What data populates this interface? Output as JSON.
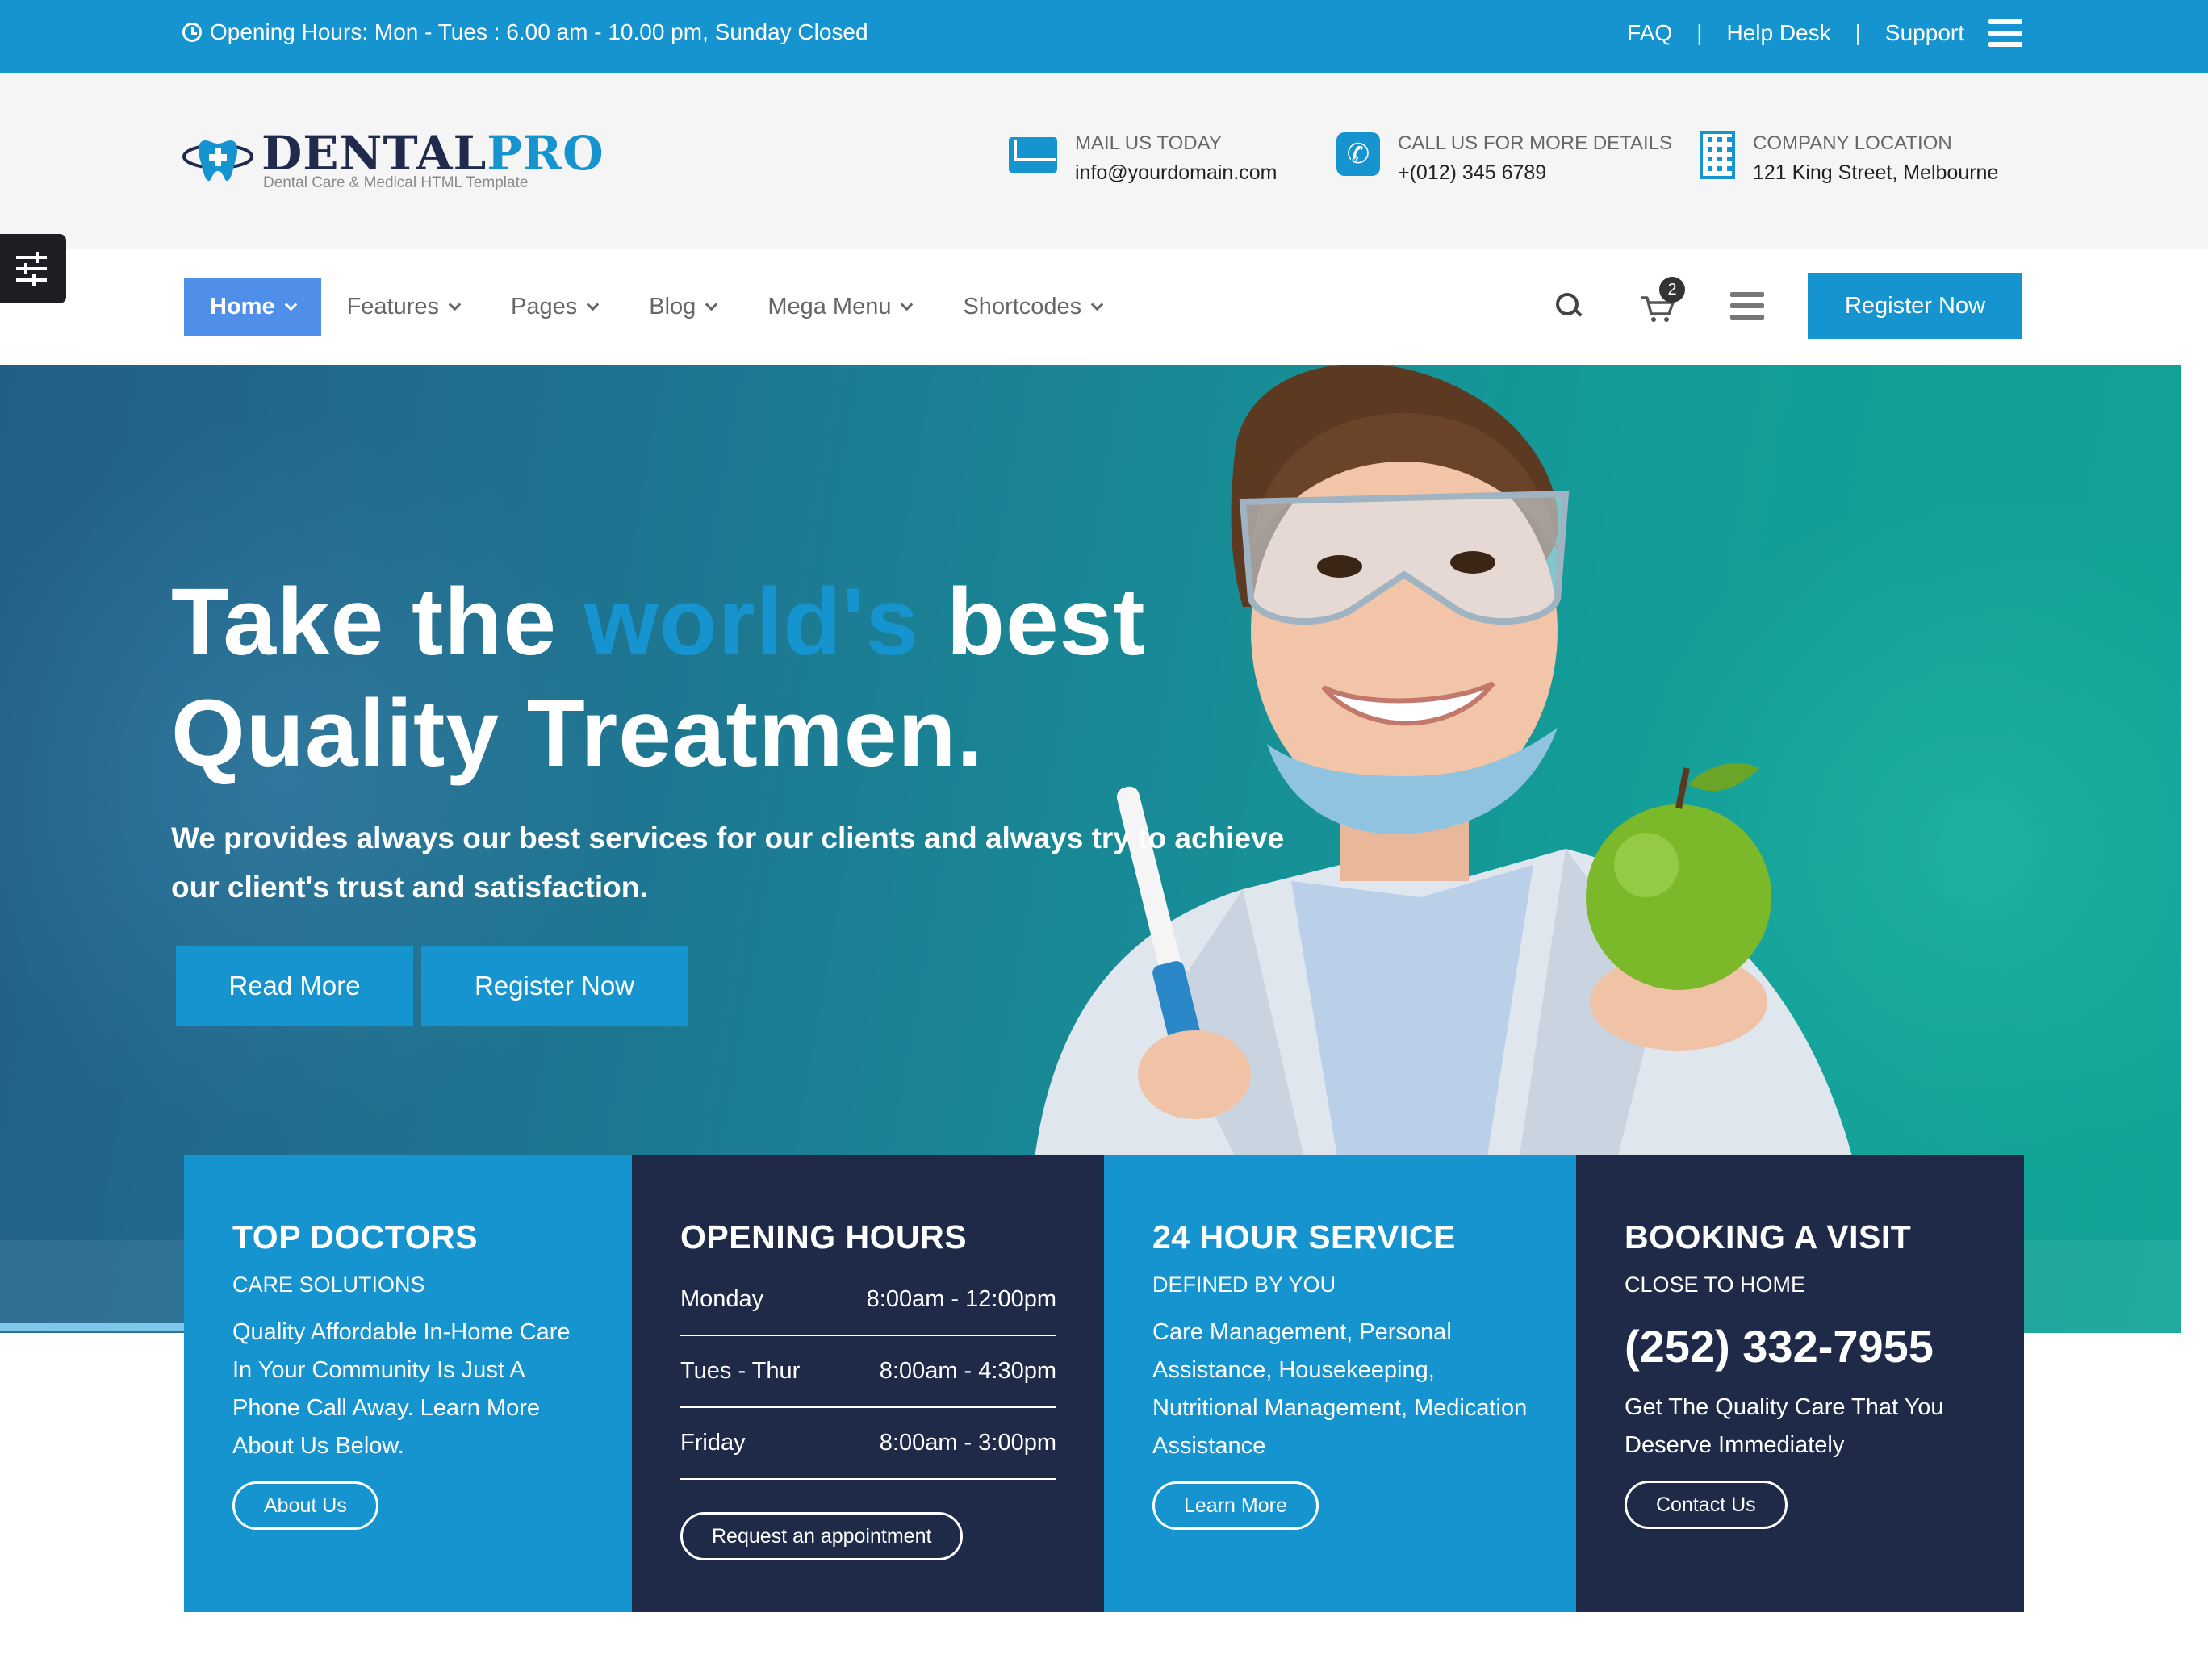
{
  "topbar": {
    "hours": "Opening Hours: Mon - Tues : 6.00 am - 10.00 pm, Sunday Closed",
    "links": [
      "FAQ",
      "Help Desk",
      "Support"
    ],
    "separator": "|",
    "menu_icon": "hamburger-icon"
  },
  "header": {
    "logo": {
      "brand_part1": "DENTAL",
      "brand_part2": "PRO",
      "tagline": "Dental Care & Medical HTML Template"
    },
    "contacts": [
      {
        "icon": "mail-icon",
        "label": "MAIL US TODAY",
        "value": "info@yourdomain.com"
      },
      {
        "icon": "phone-icon",
        "label": "CALL US FOR MORE DETAILS",
        "value": "+(012) 345 6789"
      },
      {
        "icon": "building-icon",
        "label": "COMPANY LOCATION",
        "value": "121 King Street, Melbourne"
      }
    ]
  },
  "nav": {
    "items": [
      "Home",
      "Features",
      "Pages",
      "Blog",
      "Mega Menu",
      "Shortcodes"
    ],
    "active_index": 0,
    "cart_count": "2",
    "register_label": "Register Now"
  },
  "hero": {
    "title_line1_pre": "Take the ",
    "title_line1_highlight": "world's",
    "title_line1_post": " best",
    "title_line2": "Quality Treatmen.",
    "subtitle": "We provides always our best services for our clients and always try to achieve our client's trust and satisfaction.",
    "btn_read_more": "Read More",
    "btn_register": "Register Now"
  },
  "cards": {
    "doctors": {
      "title": "TOP DOCTORS",
      "subtitle": "CARE SOLUTIONS",
      "text": "Quality Affordable In-Home Care In Your Community Is Just A Phone Call Away.  Learn More About Us Below.",
      "button": "About Us"
    },
    "hours": {
      "title": "OPENING HOURS",
      "rows": [
        {
          "day": "Monday",
          "time": "8:00am - 12:00pm"
        },
        {
          "day": "Tues - Thur",
          "time": "8:00am - 4:30pm"
        },
        {
          "day": "Friday",
          "time": "8:00am - 3:00pm"
        }
      ],
      "button": "Request an appointment"
    },
    "service": {
      "title": "24 HOUR SERVICE",
      "subtitle": "DEFINED BY YOU",
      "text": "Care Management, Personal Assistance, Housekeeping, Nutritional Management, Medication Assistance",
      "button": "Learn More"
    },
    "booking": {
      "title": "BOOKING A VISIT",
      "subtitle": "CLOSE TO HOME",
      "phone": "(252) 332-7955",
      "text": "Get The Quality Care That You Deserve Immediately",
      "button": "Contact Us"
    }
  },
  "colors": {
    "primary": "#1694cf",
    "dark": "#1f2a48",
    "nav_active": "#4f8fea",
    "hero_start": "#235e86",
    "hero_end": "#11a497"
  }
}
